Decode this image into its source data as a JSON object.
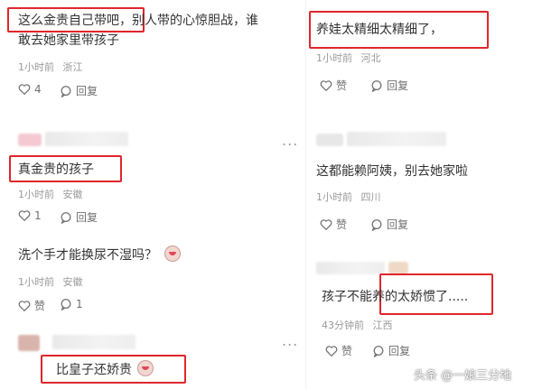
{
  "comments_left": [
    {
      "text_line1": "这么金贵自己带吧，别人带的心惊胆战，谁",
      "text_line2": "敢去她家里带孩子",
      "time": "1小时前",
      "location": "浙江",
      "like_count": "4",
      "reply_label": "回复"
    },
    {
      "text": "真金贵的孩子",
      "time": "1小时前",
      "location": "安徽",
      "like_count": "1",
      "reply_label": "回复"
    },
    {
      "text": "洗个手才能换尿不湿吗？",
      "time": "1小时前",
      "location": "安徽",
      "like_label": "赞",
      "reply_count": "1"
    },
    {
      "text": "比皇子还娇贵"
    }
  ],
  "comments_right": [
    {
      "text": "养娃太精细太精细了，",
      "time": "1小时前",
      "location": "河北",
      "like_label": "赞",
      "reply_label": "回复"
    },
    {
      "text": "这都能赖阿姨，别去她家啦",
      "time": "1小时前",
      "location": "四川",
      "like_label": "赞",
      "reply_label": "回复"
    },
    {
      "text": "孩子不能养的太娇惯了.....",
      "time": "43分钟前",
      "location": "江西",
      "like_label": "赞",
      "reply_label": "回复"
    }
  ],
  "more_label": "...",
  "watermark": "头条 @一娘三分地",
  "icons": [
    "heart-icon",
    "comment-bubble-icon",
    "clown-emoji-icon",
    "more-icon"
  ],
  "colors": {
    "highlight_border": "#e0262b",
    "meta_text": "#9a9a9a"
  }
}
